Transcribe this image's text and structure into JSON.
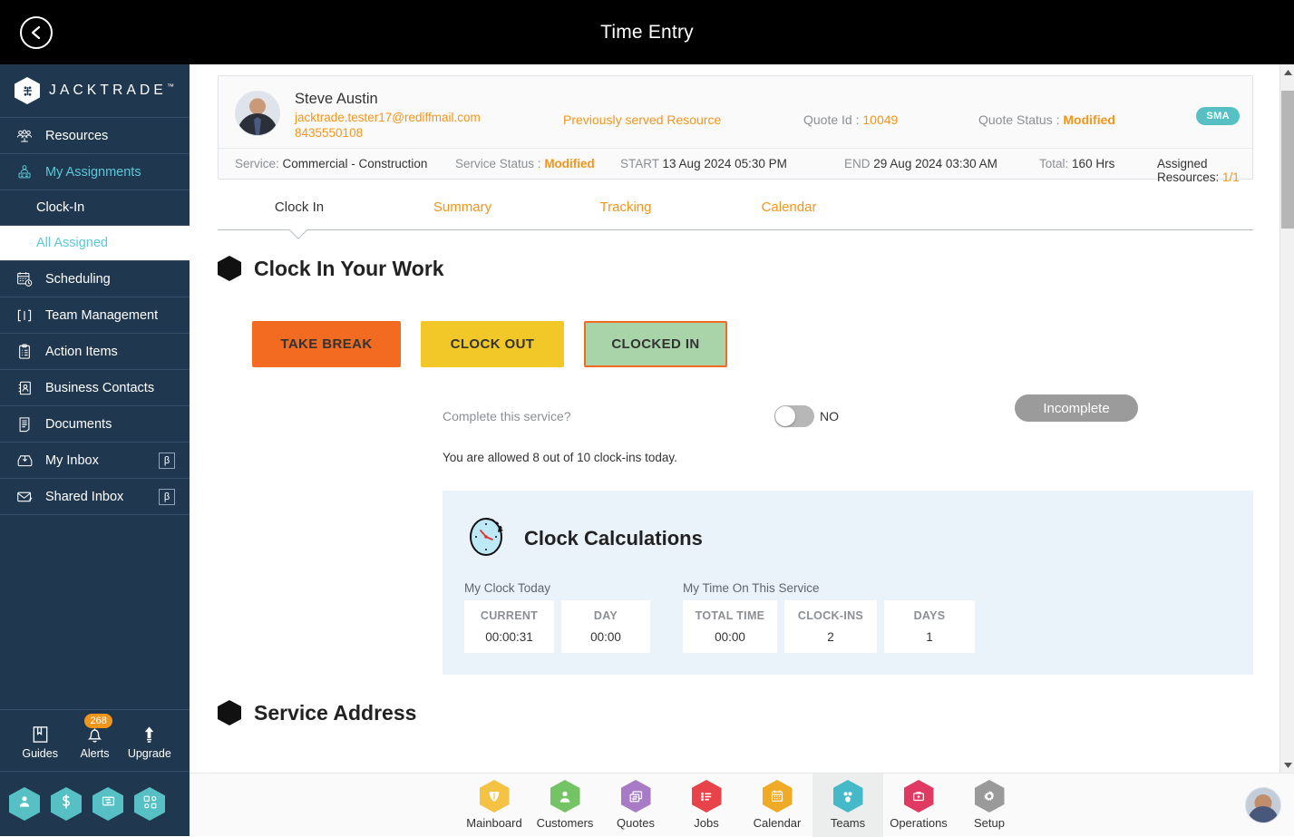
{
  "topbar": {
    "title": "Time Entry",
    "back_icon": "chevron-left-icon"
  },
  "sidebar": {
    "logo": {
      "text": "JACKTRADE",
      "tm": "™",
      "icon": "jacktrade-logo-icon"
    },
    "items": [
      {
        "label": "Resources",
        "icon": "resources-icon",
        "state": "normal"
      },
      {
        "label": "My Assignments",
        "icon": "my-assignments-icon",
        "state": "active-parent"
      },
      {
        "label": "Scheduling",
        "icon": "scheduling-icon",
        "state": "normal"
      },
      {
        "label": "Team Management",
        "icon": "team-management-icon",
        "state": "normal"
      },
      {
        "label": "Action Items",
        "icon": "action-items-icon",
        "state": "normal"
      },
      {
        "label": "Business Contacts",
        "icon": "business-contacts-icon",
        "state": "normal"
      },
      {
        "label": "Documents",
        "icon": "documents-icon",
        "state": "normal"
      },
      {
        "label": "My Inbox",
        "icon": "my-inbox-icon",
        "state": "normal",
        "badge": "β"
      },
      {
        "label": "Shared Inbox",
        "icon": "shared-inbox-icon",
        "state": "normal",
        "badge": "β"
      }
    ],
    "sub_items": [
      {
        "label": "Clock-In",
        "selected": false
      },
      {
        "label": "All Assigned",
        "selected": true
      }
    ],
    "tools": [
      {
        "label": "Guides",
        "icon": "book-icon"
      },
      {
        "label": "Alerts",
        "icon": "bell-icon",
        "count": "268"
      },
      {
        "label": "Upgrade",
        "icon": "up-arrow-icon"
      }
    ],
    "quick_actions": [
      {
        "icon": "person-hex-icon"
      },
      {
        "icon": "dollar-hex-icon"
      },
      {
        "icon": "payment-hex-icon"
      },
      {
        "icon": "workflow-hex-icon"
      }
    ]
  },
  "info_card": {
    "avatar": "user-photo",
    "name": "Steve Austin",
    "email": "jacktrade.tester17@rediffmail.com",
    "phone": "8435550108",
    "previously_served": "Previously served Resource",
    "quote_id_label": "Quote Id :",
    "quote_id_value": "10049",
    "quote_status_label": "Quote Status :",
    "quote_status_value": "Modified",
    "badge": "SMA",
    "service_label": "Service:",
    "service_value": "Commercial - Construction",
    "service_status_label": "Service Status :",
    "service_status_value": "Modified",
    "start_label": "START",
    "start_value": "13 Aug 2024 05:30 PM",
    "end_label": "END",
    "end_value": "29 Aug 2024 03:30 AM",
    "total_label": "Total:",
    "total_value": "160 Hrs",
    "assigned_label": "Assigned Resources:",
    "assigned_value": "1/1"
  },
  "tabs": [
    {
      "label": "Clock In",
      "active": true
    },
    {
      "label": "Summary",
      "active": false
    },
    {
      "label": "Tracking",
      "active": false
    },
    {
      "label": "Calendar",
      "active": false
    }
  ],
  "clock_section": {
    "title": "Clock In Your Work",
    "buttons": [
      {
        "label": "TAKE BREAK",
        "color": "#f26b21"
      },
      {
        "label": "CLOCK OUT",
        "color": "#f2c829"
      },
      {
        "label": "CLOCKED IN",
        "color": "#a9d3a8"
      }
    ],
    "complete_label": "Complete this service?",
    "toggle_state": "NO",
    "status_pill": "Incomplete",
    "allowance": "You are allowed 8 out of 10 clock-ins today."
  },
  "calc_panel": {
    "title": "Clock Calculations",
    "icon": "stopwatch-icon",
    "group1_label": "My Clock Today",
    "group2_label": "My Time On This Service",
    "stats": [
      {
        "label": "CURRENT",
        "value": "00:00:31"
      },
      {
        "label": "DAY",
        "value": "00:00"
      },
      {
        "label": "TOTAL TIME",
        "value": "00:00"
      },
      {
        "label": "CLOCK-INS",
        "value": "2"
      },
      {
        "label": "DAYS",
        "value": "1"
      }
    ]
  },
  "service_address": {
    "title": "Service Address"
  },
  "bottom_nav": [
    {
      "label": "Mainboard",
      "icon": "mainboard-icon",
      "color": "#f5c344",
      "active": false
    },
    {
      "label": "Customers",
      "icon": "customers-icon",
      "color": "#74c365",
      "active": false
    },
    {
      "label": "Quotes",
      "icon": "quotes-icon",
      "color": "#a77bc6",
      "active": false
    },
    {
      "label": "Jobs",
      "icon": "jobs-icon",
      "color": "#e8424a",
      "active": false
    },
    {
      "label": "Calendar",
      "icon": "calendar-icon",
      "color": "#f0ab26",
      "active": false
    },
    {
      "label": "Teams",
      "icon": "teams-icon",
      "color": "#45b9c7",
      "active": true
    },
    {
      "label": "Operations",
      "icon": "operations-icon",
      "color": "#e03a63",
      "active": false
    },
    {
      "label": "Setup",
      "icon": "setup-icon",
      "color": "#9a9a9a",
      "active": false
    }
  ],
  "colors": {
    "accent_orange": "#f0971b",
    "sidebar_bg": "#20384f",
    "teal": "#57c0c4",
    "panel_blue": "#eaf2fa"
  }
}
